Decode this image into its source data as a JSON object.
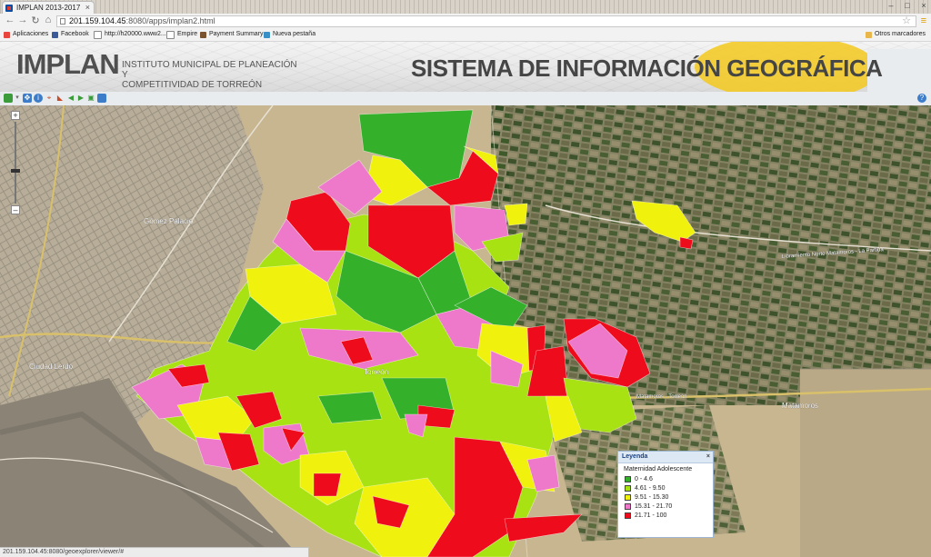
{
  "browser": {
    "tab_title": "IMPLAN 2013-2017",
    "url_host": "201.159.104.45",
    "url_rest": ":8080/apps/implan2.html",
    "bookmarks": [
      {
        "label": "Aplicaciones",
        "color": "#e8453c"
      },
      {
        "label": "Facebook",
        "color": "#3b5998"
      },
      {
        "label": "http://h20000.www2...",
        "color": "#9aa0a6"
      },
      {
        "label": "Empire",
        "color": "#9aa0a6"
      },
      {
        "label": "Payment Summary",
        "color": "#7a5230"
      },
      {
        "label": "Nueva pestaña",
        "color": "#3a8fc6"
      }
    ],
    "other_bookmarks": "Otros marcadores",
    "status_url": "201.159.104.45:8080/geoexplorer/viewer/#"
  },
  "header": {
    "brand": "IMPLAN",
    "subtitle_line1": "INSTITUTO MUNICIPAL DE PLANEACIÓN Y",
    "subtitle_line2": "COMPETITIVIDAD DE TORREÓN",
    "system_title": "SISTEMA DE INFORMACIÓN GEOGRÁFICA"
  },
  "map_tools": [
    {
      "name": "layers-tool-icon",
      "color": "#3a9b3a"
    },
    {
      "name": "pan-tool-icon",
      "color": "#3d7cc9"
    },
    {
      "name": "info-tool-icon",
      "color": "#3d7cc9"
    },
    {
      "name": "measure-tool-icon",
      "color": "#c74c2b"
    },
    {
      "name": "zoom-previous-icon",
      "color": "#3a9b3a"
    },
    {
      "name": "zoom-next-icon",
      "color": "#3a9b3a"
    },
    {
      "name": "zoom-extent-icon",
      "color": "#3a9b3a"
    },
    {
      "name": "table-tool-icon",
      "color": "#3d7cc9"
    }
  ],
  "map_labels": {
    "gomez": "Gómez Palacio",
    "lerdo": "Ciudad Lerdo",
    "torreon": "Torreón",
    "matamoros": "Matamoros",
    "road_east": "Libramiento Norte Matamoros - La Partida",
    "road_se": "Matamoros - Torreón"
  },
  "legend": {
    "header": "Leyenda",
    "title": "Maternidad Adolescente",
    "classes": [
      {
        "label": "0 - 4.6",
        "color": "#35b02a"
      },
      {
        "label": "4.61 - 9.50",
        "color": "#a8e212"
      },
      {
        "label": "9.51 - 15.30",
        "color": "#f1f10e"
      },
      {
        "label": "15.31 - 21.70",
        "color": "#ee79cb"
      },
      {
        "label": "21.71 - 100",
        "color": "#ee0b1c"
      }
    ]
  }
}
